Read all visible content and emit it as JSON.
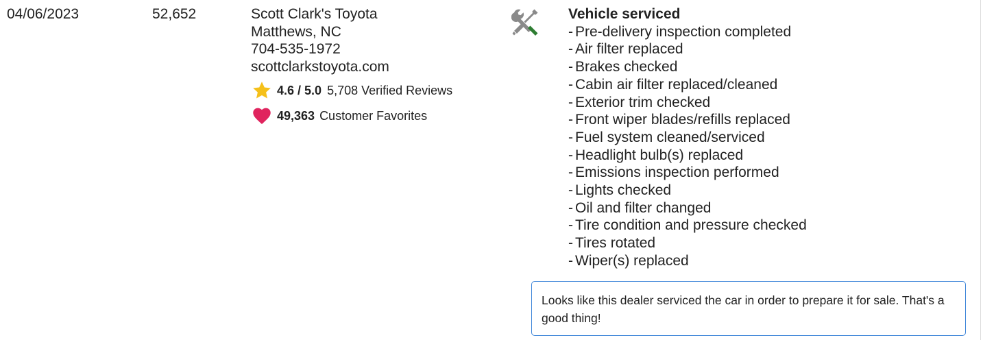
{
  "record": {
    "date": "04/06/2023",
    "mileage": "52,652",
    "source": {
      "name": "Scott Clark's Toyota",
      "location": "Matthews, NC",
      "phone": "704-535-1972",
      "website": "scottclarkstoyota.com",
      "rating_score": "4.6 / 5.0",
      "rating_reviews": "5,708 Verified Reviews",
      "favorites_count": "49,363",
      "favorites_label": "Customer Favorites"
    },
    "details": {
      "title": "Vehicle serviced",
      "items": [
        "Pre-delivery inspection completed",
        "Air filter replaced",
        "Brakes checked",
        "Cabin air filter replaced/cleaned",
        "Exterior trim checked",
        "Front wiper blades/refills replaced",
        "Fuel system cleaned/serviced",
        "Headlight bulb(s) replaced",
        "Emissions inspection performed",
        "Lights checked",
        "Oil and filter changed",
        "Tire condition and pressure checked",
        "Tires rotated",
        "Wiper(s) replaced"
      ]
    },
    "note": "Looks like this dealer serviced the car in order to prepare it for sale. That's a good thing!"
  },
  "icons": {
    "service": "wrench-screwdriver-icon",
    "rating": "star-icon",
    "favorites": "heart-icon"
  },
  "colors": {
    "star": "#f5c01a",
    "heart": "#e0245e",
    "tool_gray": "#8a8a8a",
    "tool_green": "#2e7d32",
    "note_border": "#3f86d9"
  }
}
